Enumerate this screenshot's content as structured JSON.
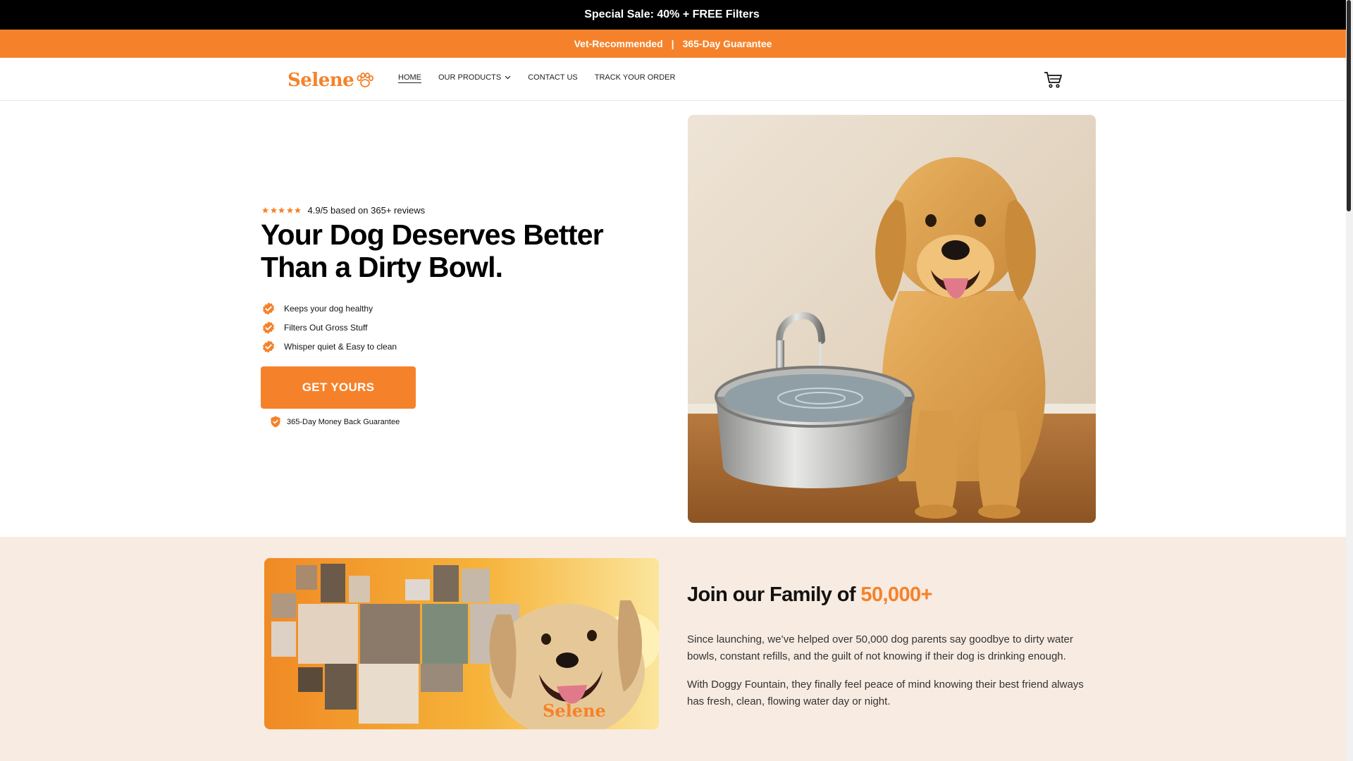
{
  "announcement": {
    "text": "Special Sale: 40% + FREE Filters"
  },
  "promo": {
    "left": "Vet-Recommended",
    "separator": "|",
    "right": "365-Day Guarantee"
  },
  "header": {
    "logo": "Selene",
    "nav": [
      {
        "label": "HOME"
      },
      {
        "label": "OUR PRODUCTS"
      },
      {
        "label": "CONTACT US"
      },
      {
        "label": "TRACK YOUR ORDER"
      }
    ],
    "cart_icon": "cart-icon"
  },
  "hero": {
    "rating_value": 4.9,
    "rating_text": "4.9/5 based on 365+ reviews",
    "headline": "Your Dog Deserves Better Than a Dirty Bowl.",
    "benefits": [
      "Keeps your dog healthy",
      "Filters Out Gross Stuff",
      "Whisper quiet & Easy to clean"
    ],
    "cta": "GET YOURS",
    "guarantee": "365-Day Money Back Guarantee"
  },
  "family": {
    "title_prefix": "Join our Family of",
    "title_accent": "50,000+",
    "paragraph1": "Since launching, we’ve helped over 50,000 dog parents say goodbye to dirty water bowls, constant refills, and the guilt of not knowing if their dog is drinking enough.",
    "paragraph2": "With Doggy Fountain, they finally feel peace of mind knowing their best friend always has fresh, clean, flowing water day or night.",
    "collage_logo": "Selene"
  },
  "colors": {
    "accent": "#f5822a",
    "dark": "#000000",
    "section_bg": "#f8ebe1"
  }
}
